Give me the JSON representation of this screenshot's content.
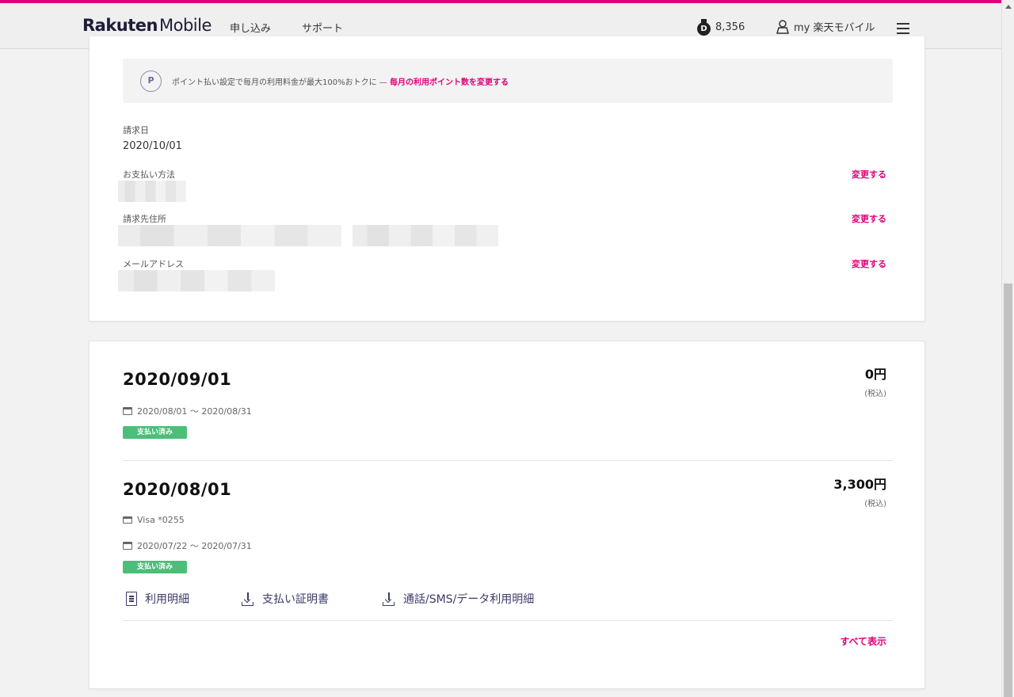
{
  "header": {
    "logo_brand": "Rakuten",
    "logo_product": "Mobile",
    "nav": [
      "申し込み",
      "サポート"
    ],
    "points": "8,356",
    "account_label": "my 楽天モバイル"
  },
  "billing_info": {
    "point_banner": {
      "icon_letter": "P",
      "text": "ポイント払い設定で毎月の利用料金が最大100%おトクに —",
      "link": "毎月の利用ポイント数を変更する"
    },
    "billing_date_label": "請求日",
    "billing_date": "2020/10/01",
    "payment_method_label": "お支払い方法",
    "billing_address_label": "請求先住所",
    "email_label": "メールアドレス",
    "change_label": "変更する"
  },
  "invoices": [
    {
      "date": "2020/09/01",
      "amount": "0円",
      "tax_note": "(税込)",
      "period": "2020/08/01 〜 2020/08/31",
      "status": "支払い済み"
    },
    {
      "date": "2020/08/01",
      "amount": "3,300円",
      "tax_note": "(税込)",
      "card": "Visa *0255",
      "period": "2020/07/22 〜 2020/07/31",
      "status": "支払い済み",
      "links": {
        "statement": "利用明細",
        "receipt": "支払い証明書",
        "usage": "通話/SMS/データ利用明細"
      }
    }
  ],
  "show_all": "すべて表示",
  "colors": {
    "accent": "#e0007a",
    "paid_badge": "#4dbe7a",
    "navy": "#1d1d3a"
  }
}
